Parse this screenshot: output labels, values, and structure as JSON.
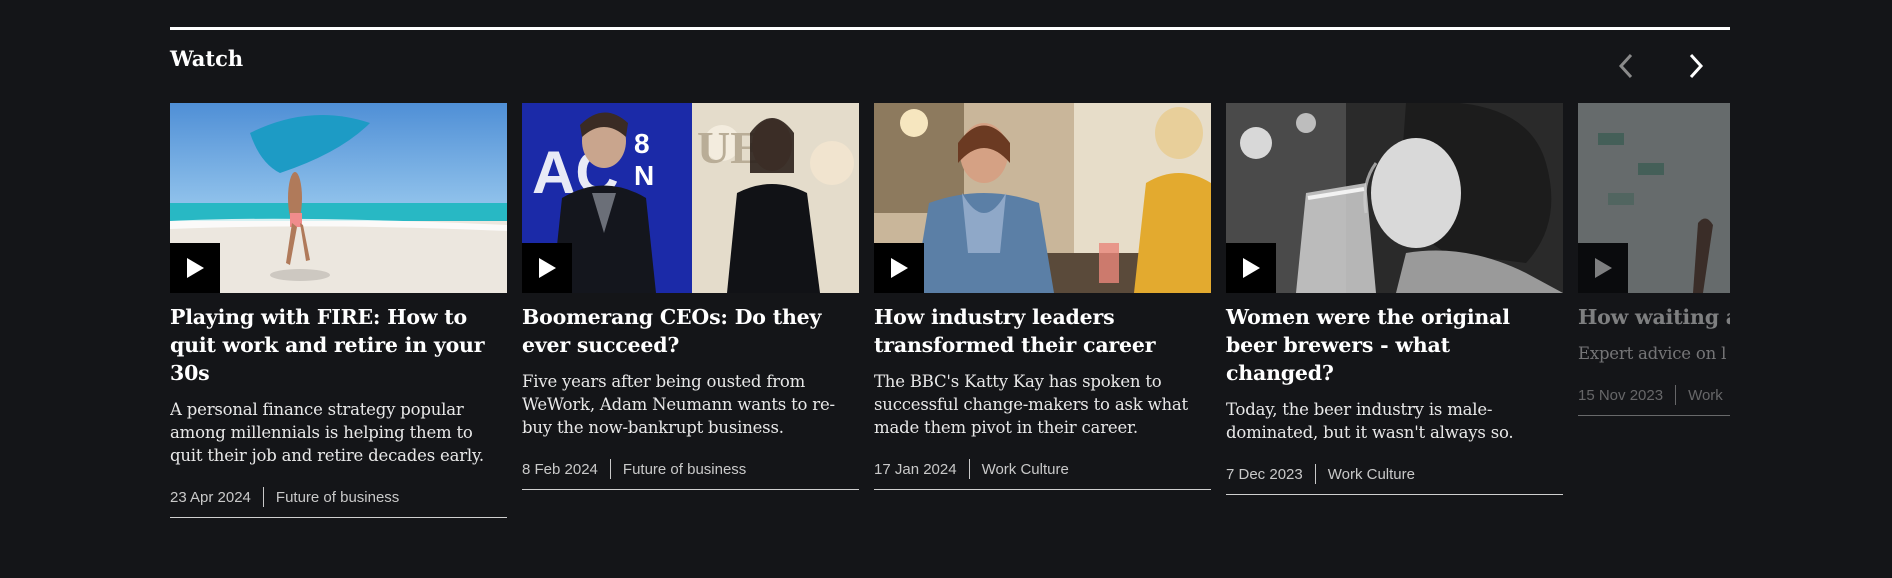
{
  "section": {
    "title": "Watch",
    "prev_icon": "chevron-left-icon",
    "next_icon": "chevron-right-icon"
  },
  "cards": [
    {
      "title": "Playing with FIRE: How to quit work and retire in your 30s",
      "description": "A personal finance strategy popular among millennials is helping them to quit their job and retire decades early.",
      "date": "23 Apr 2024",
      "tag": "Future of business"
    },
    {
      "title": "Boomerang CEOs: Do they ever succeed?",
      "description": "Five years after being ousted from WeWork, Adam Neumann wants to re-buy the now-bankrupt business.",
      "date": "8 Feb 2024",
      "tag": "Future of business"
    },
    {
      "title": "How industry leaders transformed their career",
      "description": "The BBC's Katty Kay has spoken to successful change-makers to ask what made them pivot in their career.",
      "date": "17 Jan 2024",
      "tag": "Work Culture"
    },
    {
      "title": "Women were the original beer brewers - what changed?",
      "description": "Today, the beer industry is male-dominated, but it wasn't always so.",
      "date": "7 Dec 2023",
      "tag": "Work Culture"
    },
    {
      "title": "How waiting a perception of t",
      "description": "Expert advice on l waiting period.",
      "date": "15 Nov 2023",
      "tag": "Work"
    }
  ],
  "colors": {
    "background": "#141518",
    "text": "#ffffff",
    "play_button": "#000000"
  }
}
